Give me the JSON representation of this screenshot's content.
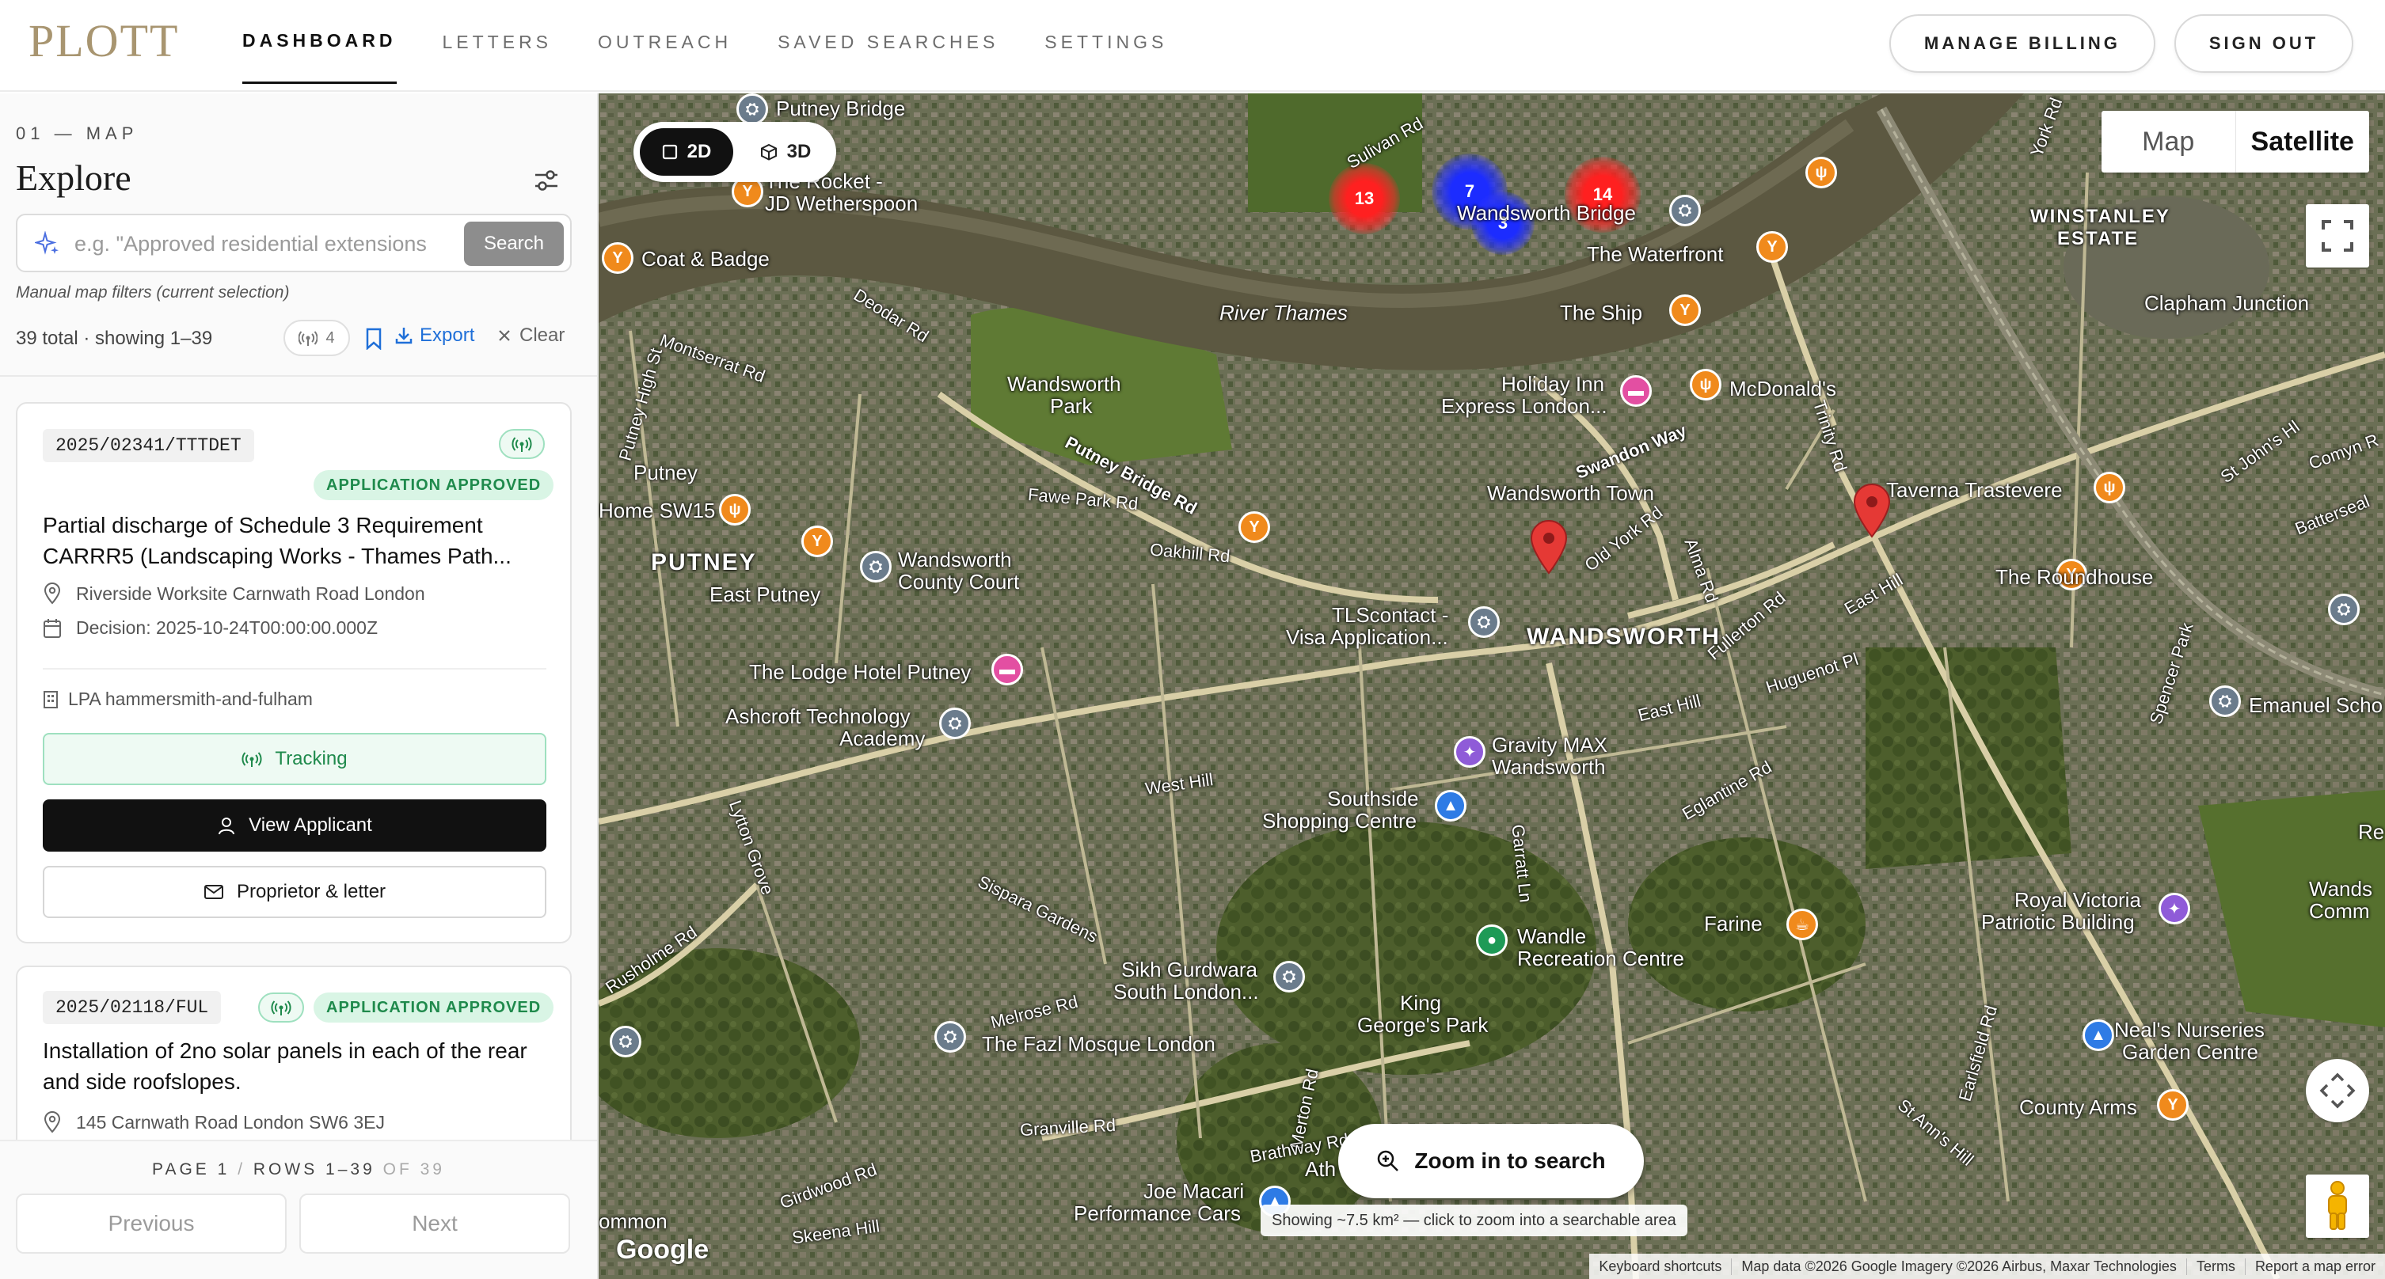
{
  "header": {
    "logo": "PLOTT",
    "nav": [
      "DASHBOARD",
      "LETTERS",
      "OUTREACH",
      "SAVED SEARCHES",
      "SETTINGS"
    ],
    "manage_billing": "MANAGE BILLING",
    "sign_out": "SIGN OUT"
  },
  "sidebar": {
    "section_label": "01 — MAP",
    "title": "Explore",
    "search": {
      "placeholder": "e.g. \"Approved residential extensions",
      "button": "Search"
    },
    "manual_note": "Manual map filters (current selection)",
    "counts": "39 total · showing 1–39",
    "tracking_count": "4",
    "export_label": "Export",
    "clear_label": "Clear",
    "cards": [
      {
        "ref": "2025/02341/TTTDET",
        "status": "APPLICATION APPROVED",
        "title": "Partial discharge of Schedule 3 Requirement CARRR5 (Landscaping Works - Thames Path...",
        "address": "Riverside Worksite Carnwath Road London",
        "decision": "Decision: 2025-10-24T00:00:00.000Z",
        "lpa": "LPA hammersmith-and-fulham",
        "tracking_label": "Tracking",
        "view_applicant_label": "View Applicant",
        "letter_label": "Proprietor & letter"
      },
      {
        "ref": "2025/02118/FUL",
        "status": "APPLICATION APPROVED",
        "title": "Installation of 2no solar panels in each of the rear and side roofslopes.",
        "address": "145 Carnwath Road London SW6 3EJ"
      }
    ],
    "pager": {
      "page_label": "PAGE",
      "page_num": "1",
      "sep": "/",
      "rows_label": "ROWS 1–39",
      "of_label": "OF 39",
      "previous": "Previous",
      "next": "Next"
    }
  },
  "map": {
    "toggle_2d": "2D",
    "toggle_3d": "3D",
    "map_type_map": "Map",
    "map_type_satellite": "Satellite",
    "zoom_search": "Zoom in to search",
    "zoom_hint": "Showing ~7.5 km² — click to zoom into a searchable area",
    "google": "Google",
    "attribution": [
      "Keyboard shortcuts",
      "Map data ©2026 Google Imagery ©2026 Airbus, Maxar Technologies",
      "Terms",
      "Report a map error"
    ],
    "clusters": [
      "13",
      "7",
      "3",
      "14"
    ],
    "labels": {
      "putney_bridge": "Putney Bridge",
      "rocket": "The Rocket -",
      "rocket2": "JD Wetherspoon",
      "coat_badge": "Coat & Badge",
      "river_thames": "River Thames",
      "wandsworth_park": "Wandsworth",
      "wandsworth_park2": "Park",
      "wandsworth_bridge": "Wandsworth Bridge",
      "waterfront": "The Waterfront",
      "the_ship": "The Ship",
      "holiday_inn": "Holiday Inn",
      "holiday_inn2": "Express London...",
      "mcdonalds": "McDonald's",
      "winstanley": "WINSTANLEY",
      "winstanley2": "ESTATE",
      "clapham_jn": "Clapham Junction",
      "putney": "PUTNEY",
      "putney_st": "Putney",
      "home_sw15": "Home SW15",
      "east_putney": "East Putney",
      "county_court": "Wandsworth",
      "county_court2": "County Court",
      "wandsworth_town": "Wandsworth Town",
      "taverna": "Taverna Trastevere",
      "roundhouse": "The Roundhouse",
      "wandsworth": "WANDSWORTH",
      "tlscontact": "TLScontact -",
      "tlscontact2": "Visa Application...",
      "lodge_hotel": "The Lodge Hotel Putney",
      "ashcroft": "Ashcroft Technology",
      "ashcroft2": "Academy",
      "gravity": "Gravity MAX",
      "gravity2": "Wandsworth",
      "southside": "Southside",
      "southside2": "Shopping Centre",
      "emanuel": "Emanuel Scho",
      "farine": "Farine",
      "royal_victoria": "Royal Victoria",
      "royal_victoria2": "Patriotic Building",
      "wandle": "Wandle",
      "wandle2": "Recreation Centre",
      "sikh": "Sikh Gurdwara",
      "sikh2": "South London...",
      "fazl": "The Fazl Mosque London",
      "king_george": "King",
      "king_george2": "George's Park",
      "neals": "Neal's Nurseries",
      "neals2": "Garden Centre",
      "county_arms": "County Arms",
      "joe_macari": "Joe Macari",
      "joe_macari2": "Performance Cars",
      "ommon": "ommon",
      "west_hill": "West Hill",
      "east_hill": "East Hill",
      "putney_bridge_rd": "Putney Bridge Rd",
      "swandon_way": "Swandon Way",
      "trinity_rd": "Trinity Rd",
      "huguenot_pl": "Huguenot Pl",
      "fawe_park_rd": "Fawe Park Rd",
      "oakhill_rd": "Oakhill Rd",
      "garratt_ln": "Garratt Ln",
      "merton_rd": "Merton Rd",
      "granville_rd": "Granville Rd",
      "melrose_rd": "Melrose Rd",
      "sispara": "Sispara Gardens",
      "st_anns_hill": "St Ann's Hill",
      "spencer_park": "Spencer Park",
      "york_rd": "York Rd",
      "montserrat_rd": "Montserrat Rd",
      "deodar_rd": "Deodar Rd",
      "putney_high_st": "Putney High St",
      "sulivan_rd": "Sulivan Rd",
      "st_johns_hill": "St John's Hl",
      "battersea_rise": "Batterseal",
      "east_hill_2": "East Hill",
      "old_york_rd": "Old York Rd",
      "alma_rd": "Alma Rd",
      "fullerton_rd": "Fullerton Rd",
      "eglantine_rd": "Eglantine Rd",
      "rusholme_rd": "Rusholme Rd",
      "lytton_grove": "Lytton Grove",
      "girdwood_rd": "Girdwood Rd",
      "skeena_hill": "Skeena Hill",
      "brathway_rd": "Brathway Rd",
      "earlsfield_rd": "Earlsfield Rd",
      "comyn": "Comyn R",
      "wands": "Wands",
      "comm": "Comm",
      "re": "Re",
      "atn": "Ath"
    }
  }
}
